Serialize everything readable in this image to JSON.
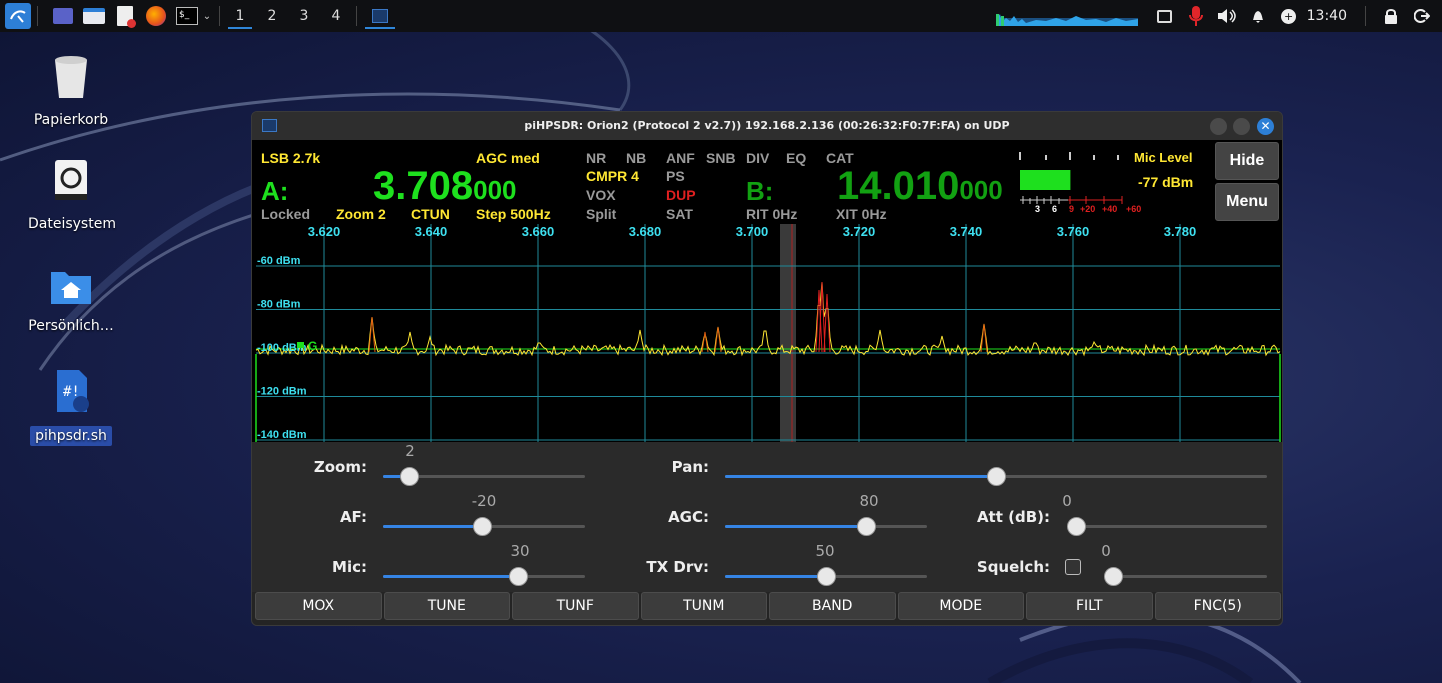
{
  "taskbar": {
    "icons": [
      "kali-menu-icon",
      "workspace-show-desktop-icon",
      "file-manager-icon",
      "text-editor-icon",
      "firefox-icon",
      "terminal-icon"
    ],
    "workspaces": [
      "1",
      "2",
      "3",
      "4"
    ],
    "active_workspace": "1",
    "clock": "13:40"
  },
  "desktop": {
    "icons": [
      {
        "label": "Papierkorb",
        "icon": "trash-icon"
      },
      {
        "label": "Dateisystem",
        "icon": "drive-icon"
      },
      {
        "label": "Persönlich…",
        "icon": "home-folder-icon"
      },
      {
        "label": "pihpsdr.sh",
        "icon": "script-file-icon"
      }
    ]
  },
  "window": {
    "title": "piHPSDR: Orion2 (Protocol 2 v2.7)) 192.168.2.136 (00:26:32:F0:7F:FA) on UDP"
  },
  "vfo": {
    "mode": "LSB 2.7k",
    "agc": "AGC med",
    "a_label": "A:",
    "a_freq_main": "3.708",
    "a_freq_small": "000",
    "b_label": "B:",
    "b_freq_main": "14.010",
    "b_freq_small": "000",
    "locked": "Locked",
    "zoom": "Zoom 2",
    "ctun": "CTUN",
    "step": "Step 500Hz",
    "flags": {
      "nr": "NR",
      "nb": "NB",
      "anf": "ANF",
      "snb": "SNB",
      "div": "DIV",
      "eq": "EQ",
      "cat": "CAT",
      "cmpr": "CMPR 4",
      "ps": "PS",
      "vox": "VOX",
      "dup": "DUP",
      "split": "Split",
      "sat": "SAT",
      "rit": "RIT 0Hz",
      "xit": "XIT 0Hz"
    },
    "meter": {
      "label": "Mic Level",
      "value": "-77 dBm",
      "scale": [
        "3",
        "6",
        "9",
        "+20",
        "+40",
        "+60"
      ],
      "level": 0.42
    },
    "hide_label": "Hide",
    "menu_label": "Menu"
  },
  "panadapter": {
    "freq_ticks": [
      "3.620",
      "3.640",
      "3.660",
      "3.680",
      "3.700",
      "3.720",
      "3.740",
      "3.760",
      "3.780"
    ],
    "dbm_ticks": [
      "-60 dBm",
      "-80 dBm",
      "-100 dBm",
      "-120 dBm",
      "-140 dBm"
    ],
    "squelch_marker": "G",
    "colors": {
      "grid": "#1f8a9a",
      "trace": "#ffe733",
      "peak": "#e06010",
      "marker": "#1ee01e"
    }
  },
  "controls": {
    "zoom": {
      "label": "Zoom:",
      "value": "2",
      "fraction": 0.13
    },
    "pan": {
      "label": "Pan:",
      "fraction": 0.5
    },
    "af": {
      "label": "AF:",
      "value": "-20",
      "fraction": 0.49
    },
    "agc": {
      "label": "AGC:",
      "value": "80",
      "fraction": 0.7
    },
    "att": {
      "label": "Att (dB):",
      "value": "0",
      "fraction": 0.0
    },
    "mic": {
      "label": "Mic:",
      "value": "30",
      "fraction": 0.67
    },
    "txdrv": {
      "label": "TX Drv:",
      "value": "50",
      "fraction": 0.5
    },
    "squelch": {
      "label": "Squelch:",
      "value": "0",
      "fraction": 0.0,
      "checked": false
    }
  },
  "buttons": [
    "MOX",
    "TUNE",
    "TUNF",
    "TUNM",
    "BAND",
    "MODE",
    "FILT",
    "FNC(5)"
  ]
}
